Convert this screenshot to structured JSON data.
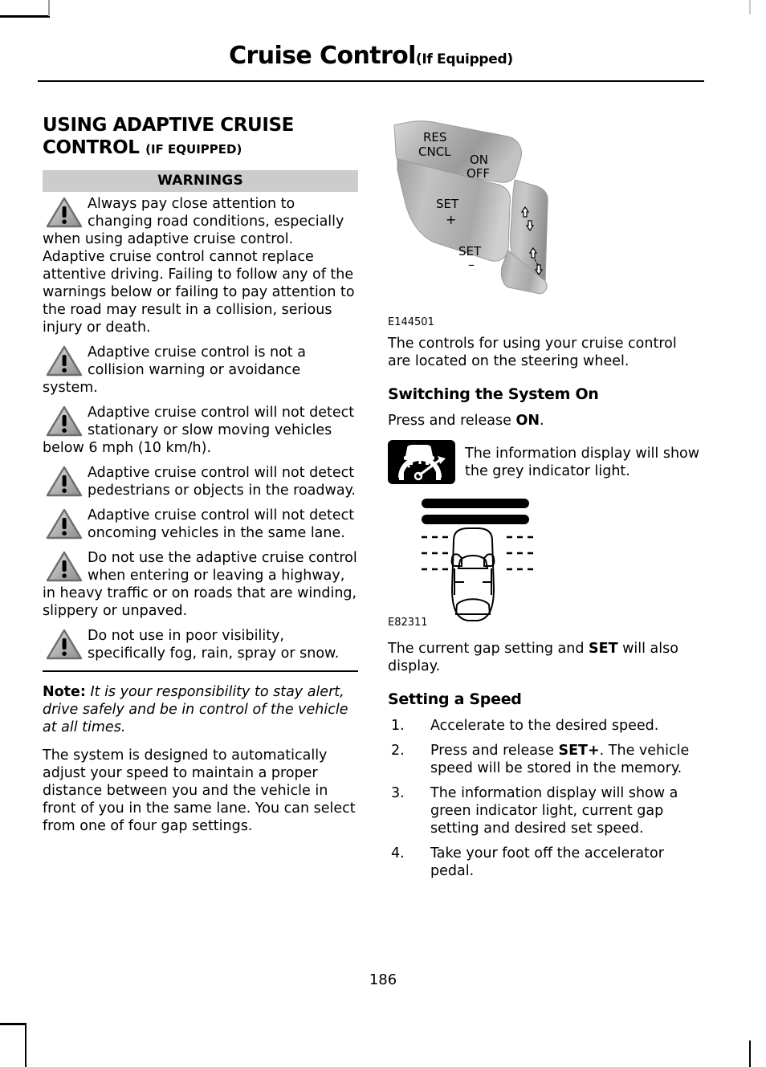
{
  "header": {
    "title": "Cruise Control",
    "qualifier": "(If Equipped)"
  },
  "left_column": {
    "heading": "USING ADAPTIVE CRUISE CONTROL",
    "heading_qualifier": "(IF EQUIPPED)",
    "warnings_bar_label": "WARNINGS",
    "warnings": [
      {
        "icon": "warning-triangle-icon",
        "text": "Always pay close attention to changing road conditions, especially when using adaptive cruise control. Adaptive cruise control cannot replace attentive driving. Failing to follow any of the warnings below or failing to pay attention to the road may result in a collision, serious injury or death."
      },
      {
        "icon": "warning-triangle-icon",
        "text": "Adaptive cruise control is not a collision warning or avoidance system."
      },
      {
        "icon": "warning-triangle-icon",
        "text": "Adaptive cruise control will not detect stationary or slow moving vehicles below 6 mph (10 km/h)."
      },
      {
        "icon": "warning-triangle-icon",
        "text": "Adaptive cruise control will not detect pedestrians or objects in the roadway."
      },
      {
        "icon": "warning-triangle-icon",
        "text": "Adaptive cruise control will not detect oncoming vehicles in the same lane."
      },
      {
        "icon": "warning-triangle-icon",
        "text": "Do not use the adaptive cruise control when entering or leaving a highway, in heavy traffic or on roads that are winding, slippery or unpaved."
      },
      {
        "icon": "warning-triangle-icon",
        "text": "Do not use in poor visibility, specifically fog, rain, spray or snow."
      }
    ],
    "note": {
      "label": "Note:",
      "text": "It is your responsibility to stay alert, drive safely and be in control of the vehicle at all times."
    },
    "closing_paragraph": "The system is designed to automatically adjust your speed to maintain a proper distance between you and the vehicle in front of you in the same lane. You can select from one of four gap settings."
  },
  "right_column": {
    "steering_wheel_figure": {
      "caption": "E144501",
      "labels": {
        "res": "RES",
        "cncl": "CNCL",
        "on": "ON",
        "off": "OFF",
        "set_plus_label": "SET",
        "set_plus_sign": "+",
        "set_minus_label": "SET",
        "set_minus_sign": "–"
      }
    },
    "controls_paragraph": "The controls for using your cruise control are located on the steering wheel.",
    "switching_heading": "Switching the System On",
    "press_release": {
      "prefix": "Press and release ",
      "bold": "ON",
      "suffix": "."
    },
    "indicator_note": {
      "icon": "cruise-control-indicator-icon",
      "text": "The information display will show the grey indicator light."
    },
    "gap_display_figure": {
      "caption": "E82311",
      "description": "vehicle-gap-display"
    },
    "gap_paragraph": {
      "prefix": "The current gap setting and ",
      "bold": "SET",
      "suffix": " will also display."
    },
    "setting_speed_heading": "Setting a Speed",
    "steps": [
      {
        "num": "1.",
        "prefix": "Accelerate to the desired speed.",
        "bold": "",
        "suffix": ""
      },
      {
        "num": "2.",
        "prefix": "Press and release ",
        "bold": "SET+",
        "suffix": ". The vehicle speed will be stored in the memory."
      },
      {
        "num": "3.",
        "prefix": "The information display will show a green indicator light, current gap setting and desired set speed.",
        "bold": "",
        "suffix": ""
      },
      {
        "num": "4.",
        "prefix": "Take your foot off the accelerator pedal.",
        "bold": "",
        "suffix": ""
      }
    ]
  },
  "footer": {
    "page_number": "186"
  },
  "colors": {
    "warnings_bar": "#cccccc",
    "text": "#000000",
    "icon_background": "#000000",
    "rule": "#000000"
  }
}
